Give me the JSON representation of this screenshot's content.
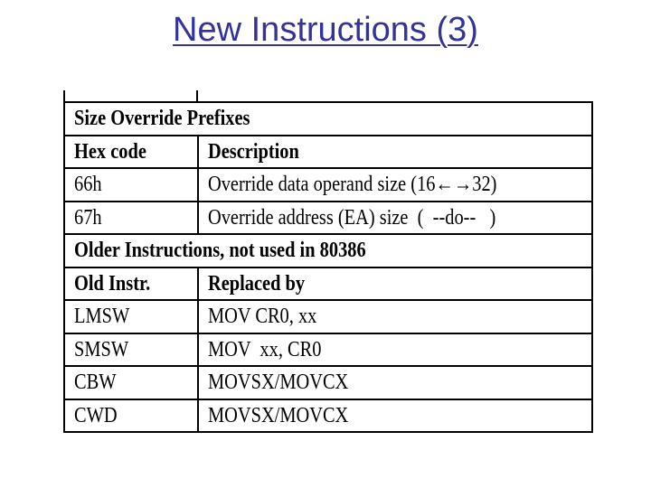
{
  "title": "New Instructions (3)",
  "sections": [
    {
      "heading": "Size Override Prefixes",
      "columns": [
        "Hex code",
        "Description"
      ],
      "rows": [
        [
          "66h",
          "Override data operand size  (16←→32)"
        ],
        [
          "67h",
          "Override address (EA) size  (  --do--   )"
        ]
      ]
    },
    {
      "heading": "Older Instructions, not used in 80386",
      "columns": [
        "Old Instr.",
        "Replaced by"
      ],
      "rows": [
        [
          "LMSW",
          "MOV CR0, xx"
        ],
        [
          "SMSW",
          "MOV  xx, CR0"
        ],
        [
          "CBW",
          "MOVSX/MOVCX"
        ],
        [
          "CWD",
          "MOVSX/MOVCX"
        ]
      ]
    }
  ]
}
